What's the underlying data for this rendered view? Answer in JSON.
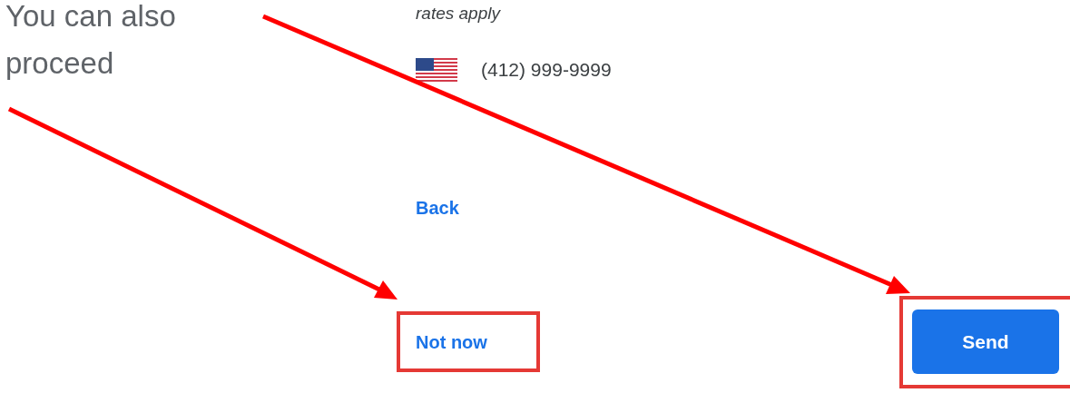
{
  "annotation": {
    "lines": [
      "You can also",
      "proceed"
    ]
  },
  "form": {
    "note": "rates apply",
    "phone": "(412) 999-9999",
    "back_link": "Back",
    "secondary_button": "Not now",
    "primary_button": "Send"
  }
}
